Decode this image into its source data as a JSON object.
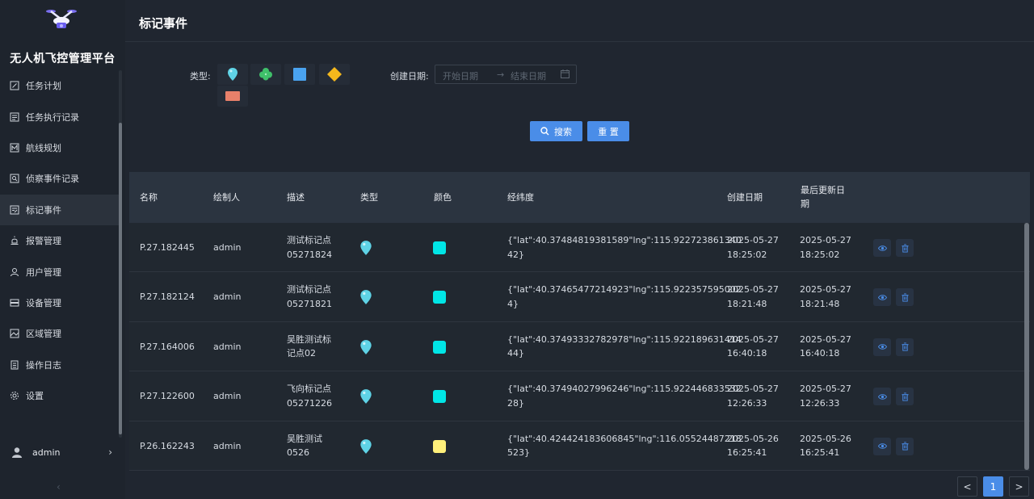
{
  "app": {
    "platform_title": "无人机飞控管理平台"
  },
  "sidebar": {
    "items": [
      {
        "label": "任务计划",
        "icon": "edit-icon",
        "active": false
      },
      {
        "label": "任务执行记录",
        "icon": "list-icon",
        "active": false
      },
      {
        "label": "航线规划",
        "icon": "route-icon",
        "active": false
      },
      {
        "label": "侦察事件记录",
        "icon": "search-doc-icon",
        "active": false
      },
      {
        "label": "标记事件",
        "icon": "mark-icon",
        "active": true
      },
      {
        "label": "报警管理",
        "icon": "alarm-icon",
        "active": false
      },
      {
        "label": "用户管理",
        "icon": "user-icon",
        "active": false
      },
      {
        "label": "设备管理",
        "icon": "device-icon",
        "active": false
      },
      {
        "label": "区域管理",
        "icon": "area-icon",
        "active": false
      },
      {
        "label": "操作日志",
        "icon": "log-icon",
        "active": false
      },
      {
        "label": "设置",
        "icon": "gear-icon",
        "active": false
      }
    ],
    "user": {
      "name": "admin"
    },
    "collapse_glyph": "‹"
  },
  "header": {
    "title": "标记事件"
  },
  "filters": {
    "type_label": "类型:",
    "type_options": [
      "pin",
      "clover",
      "square",
      "diamond",
      "rectangle"
    ],
    "date_label": "创建日期:",
    "date_start_placeholder": "开始日期",
    "date_arrow": "→",
    "date_end_placeholder": "结束日期",
    "search_label": "搜索",
    "reset_label": "重 置"
  },
  "table": {
    "columns": [
      "名称",
      "绘制人",
      "描述",
      "类型",
      "颜色",
      "经纬度",
      "创建日期",
      "最后更新日期"
    ],
    "rows": [
      {
        "name": "P.27.182445",
        "author": "admin",
        "desc": [
          "测试标记点",
          "05271824"
        ],
        "type": "pin",
        "color": "#00e6e6",
        "coord": [
          "{\"lat\":40.37484819381589\"lng\":115.922723861340",
          "42}"
        ],
        "created": [
          "2025-05-27",
          "18:25:02"
        ],
        "updated": [
          "2025-05-27",
          "18:25:02"
        ]
      },
      {
        "name": "P.27.182124",
        "author": "admin",
        "desc": [
          "测试标记点",
          "05271821"
        ],
        "type": "pin",
        "color": "#00e6e6",
        "coord": [
          "{\"lat\":40.37465477214923\"lng\":115.922357595002",
          "4}"
        ],
        "created": [
          "2025-05-27",
          "18:21:48"
        ],
        "updated": [
          "2025-05-27",
          "18:21:48"
        ]
      },
      {
        "name": "P.27.164006",
        "author": "admin",
        "desc": [
          "吴胜测试标",
          "记点02"
        ],
        "type": "pin",
        "color": "#00e6e6",
        "coord": [
          "{\"lat\":40.37493332782978\"lng\":115.922189631414",
          "44}"
        ],
        "created": [
          "2025-05-27",
          "16:40:18"
        ],
        "updated": [
          "2025-05-27",
          "16:40:18"
        ]
      },
      {
        "name": "P.27.122600",
        "author": "admin",
        "desc": [
          "飞向标记点",
          "05271226"
        ],
        "type": "pin",
        "color": "#00e6e6",
        "coord": [
          "{\"lat\":40.37494027996246\"lng\":115.922446833532",
          "28}"
        ],
        "created": [
          "2025-05-27",
          "12:26:33"
        ],
        "updated": [
          "2025-05-27",
          "12:26:33"
        ]
      },
      {
        "name": "P.26.162243",
        "author": "admin",
        "desc": [
          "吴胜测试",
          "0526"
        ],
        "type": "pin",
        "color": "#fff07a",
        "coord": [
          "{\"lat\":40.424424183606845\"lng\":116.05524487218",
          "523}"
        ],
        "created": [
          "2025-05-26",
          "16:25:41"
        ],
        "updated": [
          "2025-05-26",
          "16:25:41"
        ]
      }
    ]
  },
  "pagination": {
    "prev_glyph": "<",
    "current_page": "1",
    "next_glyph": ">"
  },
  "colors": {
    "accent": "#4a8de8",
    "pin": "#5fd3e6",
    "clover": "#3fc06a",
    "square": "#4aa3f0",
    "diamond": "#f5b81c",
    "rectangle": "#e8806a"
  }
}
